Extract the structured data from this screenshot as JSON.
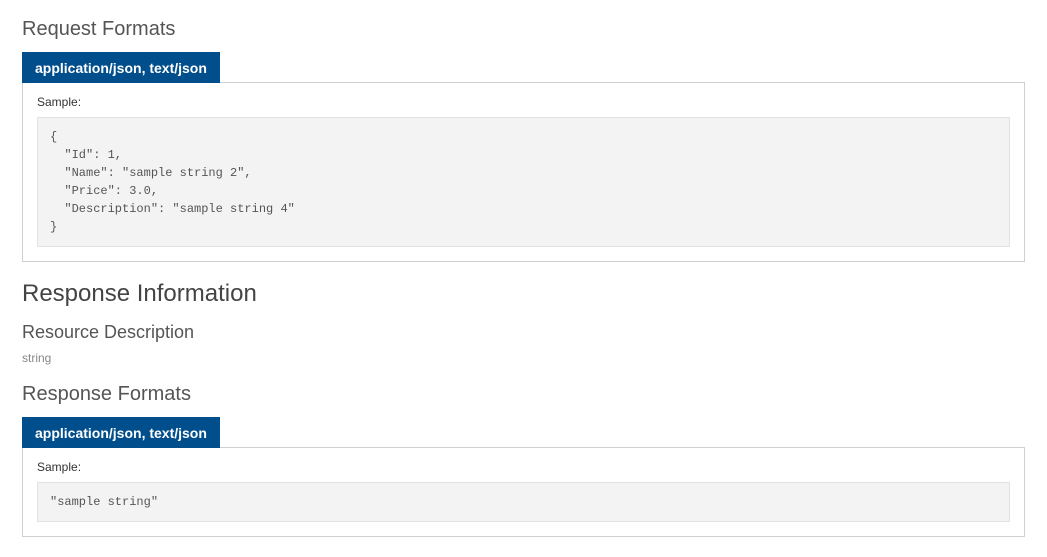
{
  "request": {
    "title": "Request Formats",
    "tabLabel": "application/json, text/json",
    "sampleLabel": "Sample:",
    "sampleCode": "{\n  \"Id\": 1,\n  \"Name\": \"sample string 2\",\n  \"Price\": 3.0,\n  \"Description\": \"sample string 4\"\n}"
  },
  "response": {
    "infoTitle": "Response Information",
    "resourceTitle": "Resource Description",
    "resourceType": "string",
    "formatsTitle": "Response Formats",
    "tabLabel": "application/json, text/json",
    "sampleLabel": "Sample:",
    "sampleCode": "\"sample string\""
  }
}
